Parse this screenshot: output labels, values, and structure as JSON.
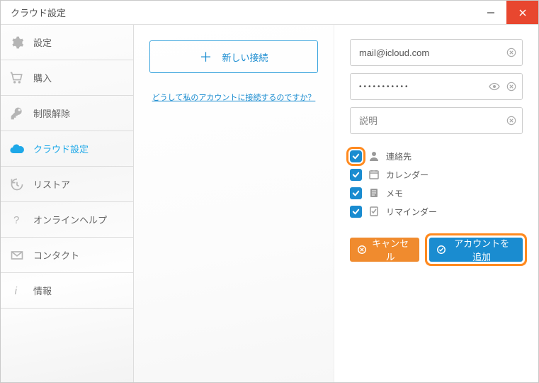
{
  "window": {
    "title": "クラウド設定"
  },
  "sidebar": {
    "items": [
      {
        "label": "設定",
        "icon": "gear-icon"
      },
      {
        "label": "購入",
        "icon": "cart-icon"
      },
      {
        "label": "制限解除",
        "icon": "key-icon"
      },
      {
        "label": "クラウド設定",
        "icon": "cloud-icon"
      },
      {
        "label": "リストア",
        "icon": "restore-icon"
      },
      {
        "label": "オンラインヘルプ",
        "icon": "help-icon"
      },
      {
        "label": "コンタクト",
        "icon": "mail-icon"
      },
      {
        "label": "情報",
        "icon": "info-icon"
      }
    ]
  },
  "mid": {
    "new_connection": "新しい接続",
    "why_link": "どうして私のアカウントに接続するのですか？"
  },
  "form": {
    "email": {
      "value": "mail@icloud.com",
      "placeholder": ""
    },
    "password": {
      "value": "•••••••••••",
      "placeholder": ""
    },
    "description": {
      "value": "",
      "placeholder": "説明"
    },
    "options": [
      {
        "label": "連絡先",
        "icon": "contact-icon",
        "checked": true
      },
      {
        "label": "カレンダー",
        "icon": "calendar-icon",
        "checked": true
      },
      {
        "label": "メモ",
        "icon": "memo-icon",
        "checked": true
      },
      {
        "label": "リマインダー",
        "icon": "reminder-icon",
        "checked": true
      }
    ],
    "cancel": "キャンセル",
    "add": "アカウントを追加"
  }
}
